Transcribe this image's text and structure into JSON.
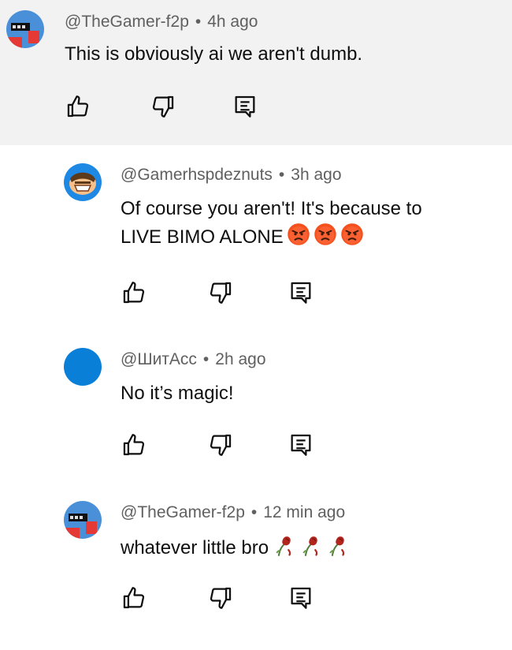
{
  "comments": [
    {
      "author": "@TheGamer-f2p",
      "time": "4h ago",
      "text": "This is obviously ai we aren't dumb.",
      "avatar": "gamer-avatar",
      "avatar_color": "#4a90d9"
    },
    {
      "author": "@Gamerhspdeznuts",
      "time": "3h ago",
      "text_line1": "Of course you aren't! It's because to",
      "text_line2": "LIVE BIMO ALONE",
      "emoji": [
        "angry-face-icon",
        "angry-face-icon",
        "angry-face-icon"
      ],
      "avatar": "cartoon-face-avatar",
      "avatar_color": "#1e88e5"
    },
    {
      "author": "@ШитAcc",
      "time": "2h ago",
      "text": "No it’s magic!",
      "avatar": "default-avatar",
      "avatar_color": "#0a7fd8"
    },
    {
      "author": "@TheGamer-f2p",
      "time": "12 min ago",
      "text": "whatever little bro",
      "emoji": [
        "wilted-flower-icon",
        "wilted-flower-icon",
        "wilted-flower-icon"
      ],
      "avatar": "gamer-avatar",
      "avatar_color": "#4a90d9"
    }
  ],
  "actions": {
    "like": "like-icon",
    "dislike": "dislike-icon",
    "reply": "reply-icon"
  },
  "colors": {
    "highlight_bg": "#f2f2f2",
    "meta_text": "#606060",
    "body_text": "#0f0f0f"
  }
}
